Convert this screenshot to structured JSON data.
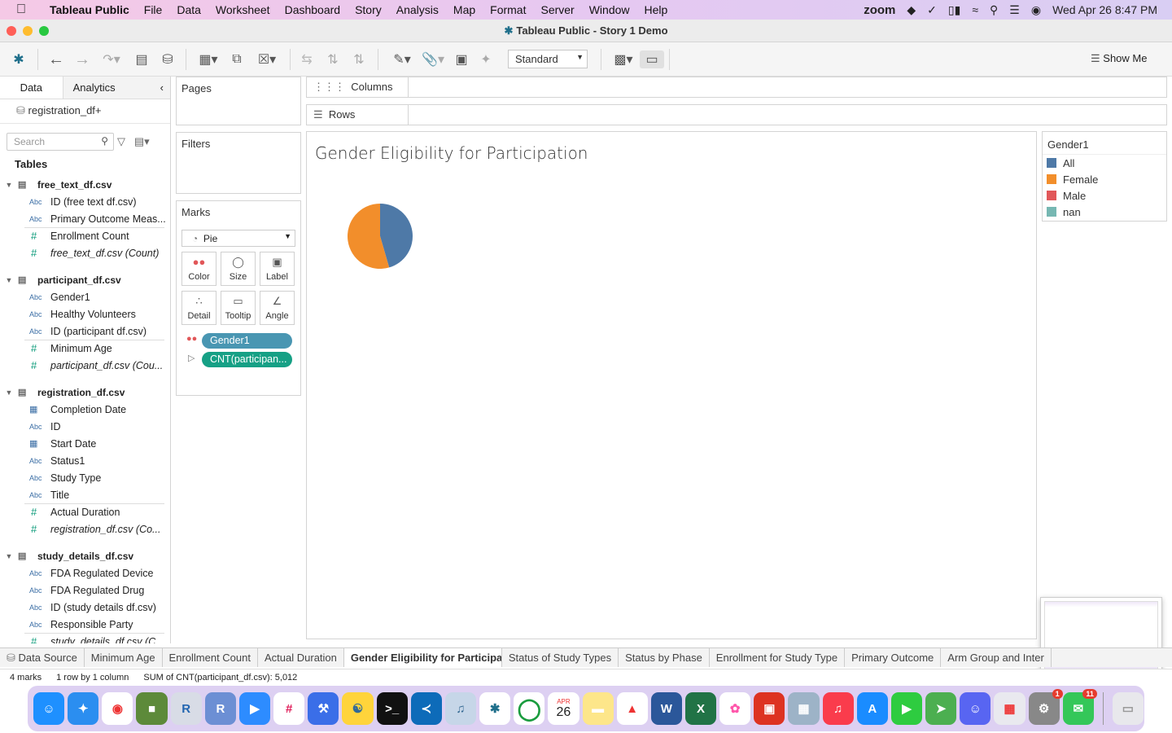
{
  "menubar": {
    "app": "Tableau Public",
    "items": [
      "File",
      "Data",
      "Worksheet",
      "Dashboard",
      "Story",
      "Analysis",
      "Map",
      "Format",
      "Server",
      "Window",
      "Help"
    ],
    "zoom": "zoom",
    "clock": "Wed Apr 26  8:47 PM"
  },
  "window": {
    "title": "Tableau Public - Story 1 Demo"
  },
  "toolbar": {
    "fit": "Standard",
    "show_me": "Show Me"
  },
  "sidebar": {
    "tab_data": "Data",
    "tab_analytics": "Analytics",
    "datasource": "registration_df+",
    "search_placeholder": "Search",
    "tables_heading": "Tables"
  },
  "tables": [
    {
      "name": "free_text_df.csv",
      "fields": [
        {
          "type": "Abc",
          "name": "ID (free text df.csv)"
        },
        {
          "type": "Abc",
          "name": "Primary Outcome Meas..."
        },
        {
          "type": "#",
          "name": "Enrollment Count"
        },
        {
          "type": "#",
          "name": "free_text_df.csv (Count)",
          "italic": true
        }
      ]
    },
    {
      "name": "participant_df.csv",
      "fields": [
        {
          "type": "Abc",
          "name": "Gender1"
        },
        {
          "type": "Abc",
          "name": "Healthy Volunteers"
        },
        {
          "type": "Abc",
          "name": "ID (participant df.csv)"
        },
        {
          "type": "#",
          "name": "Minimum Age"
        },
        {
          "type": "#",
          "name": "participant_df.csv (Cou...",
          "italic": true
        }
      ]
    },
    {
      "name": "registration_df.csv",
      "fields": [
        {
          "type": "date",
          "name": "Completion Date"
        },
        {
          "type": "Abc",
          "name": "ID"
        },
        {
          "type": "date",
          "name": "Start Date"
        },
        {
          "type": "Abc",
          "name": "Status1"
        },
        {
          "type": "Abc",
          "name": "Study Type"
        },
        {
          "type": "Abc",
          "name": "Title"
        },
        {
          "type": "#",
          "name": "Actual Duration"
        },
        {
          "type": "#",
          "name": "registration_df.csv (Co...",
          "italic": true
        }
      ]
    },
    {
      "name": "study_details_df.csv",
      "fields": [
        {
          "type": "Abc",
          "name": "FDA Regulated Device"
        },
        {
          "type": "Abc",
          "name": "FDA Regulated Drug"
        },
        {
          "type": "Abc",
          "name": "ID (study details df.csv)"
        },
        {
          "type": "Abc",
          "name": "Responsible Party"
        },
        {
          "type": "#",
          "name": "study_details_df.csv (C...",
          "italic": true
        }
      ]
    }
  ],
  "cards": {
    "pages": "Pages",
    "filters": "Filters",
    "marks": "Marks",
    "mark_type": "Pie",
    "buttons": [
      "Color",
      "Size",
      "Label",
      "Detail",
      "Tooltip",
      "Angle"
    ],
    "pill_color": "Gender1",
    "pill_angle": "CNT(participan..."
  },
  "shelves": {
    "columns": "Columns",
    "rows": "Rows"
  },
  "view": {
    "title": "Gender Eligibility for Participation"
  },
  "legend": {
    "title": "Gender1",
    "items": [
      {
        "label": "All",
        "color": "#4e79a7"
      },
      {
        "label": "Female",
        "color": "#f28e2b"
      },
      {
        "label": "Male",
        "color": "#e15759"
      },
      {
        "label": "nan",
        "color": "#76b7b2"
      }
    ]
  },
  "chart_data": {
    "type": "pie",
    "title": "Gender Eligibility for Participation",
    "legend_title": "Gender1",
    "slices": [
      {
        "label": "All",
        "share": 0.455,
        "color": "#4e79a7"
      },
      {
        "label": "Female",
        "share": 0.545,
        "color": "#f28e2b"
      }
    ]
  },
  "sheet_tabs": {
    "data_source": "Data Source",
    "tabs": [
      "Minimum Age",
      "Enrollment Count",
      "Actual Duration",
      "Gender Eligibility for Participat...",
      "Status of Study Types",
      "Status by Phase",
      "Enrollment for Study Type",
      "Primary Outcome",
      "Arm Group and Inter"
    ],
    "active": 3
  },
  "status": {
    "marks": "4 marks",
    "dims": "1 row by 1 column",
    "sum": "SUM of CNT(participant_df.csv): 5,012"
  },
  "dock": {
    "calendar_month": "APR",
    "calendar_day": "26",
    "badge_settings": "1",
    "badge_messages": "11"
  }
}
